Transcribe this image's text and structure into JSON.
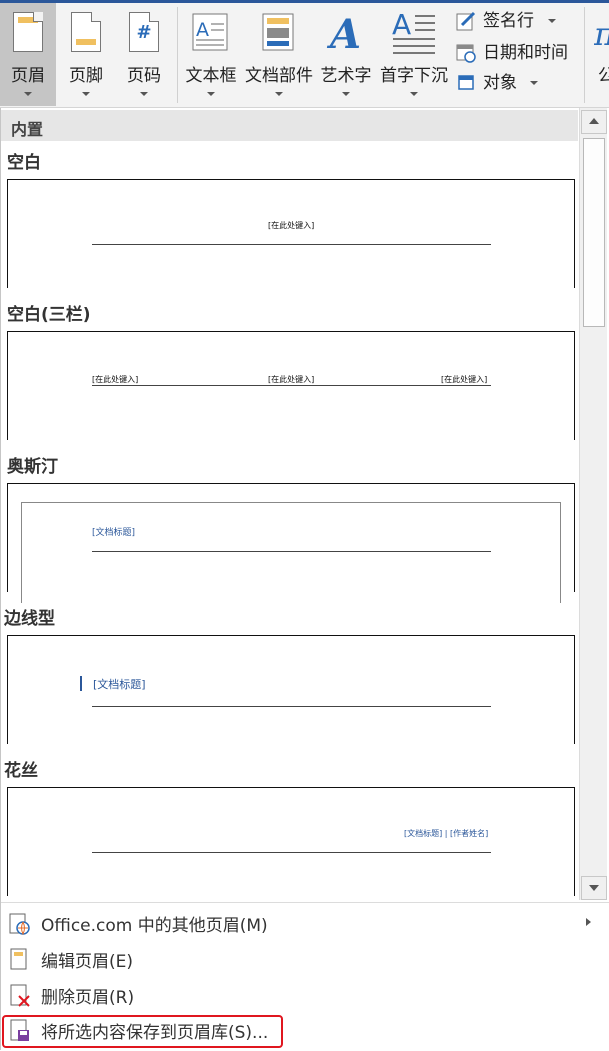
{
  "ribbon": {
    "header_label": "页眉",
    "footer_label": "页脚",
    "page_number_label": "页码",
    "textbox_label": "文本框",
    "quick_parts_label": "文档部件",
    "wordart_label": "艺术字",
    "dropcap_label": "首字下沉",
    "signature_line_label": "签名行",
    "datetime_label": "日期和时间",
    "object_label": "对象",
    "partial_label": "公"
  },
  "gallery": {
    "builtin_label": "内置",
    "sections": [
      {
        "title": "空白",
        "placeholder": "[在此处键入]"
      },
      {
        "title": "空白(三栏)",
        "left": "[在此处键入]",
        "center": "[在此处键入]",
        "right": "[在此处键入]"
      },
      {
        "title": "奥斯汀",
        "placeholder": "[文档标题]"
      },
      {
        "title": "边线型",
        "placeholder": "[文档标题]"
      },
      {
        "title": "花丝",
        "placeholder": "[文档标题] | [作者姓名]"
      }
    ]
  },
  "menu": {
    "office_more": "Office.com 中的其他页眉(M)",
    "edit_header": "编辑页眉(E)",
    "remove_header": "删除页眉(R)",
    "save_selection": "将所选内容保存到页眉库(S)..."
  },
  "colors": {
    "accent": "#2b579a",
    "highlight": "#e0161f",
    "selected_button": "#c5c5c5"
  }
}
